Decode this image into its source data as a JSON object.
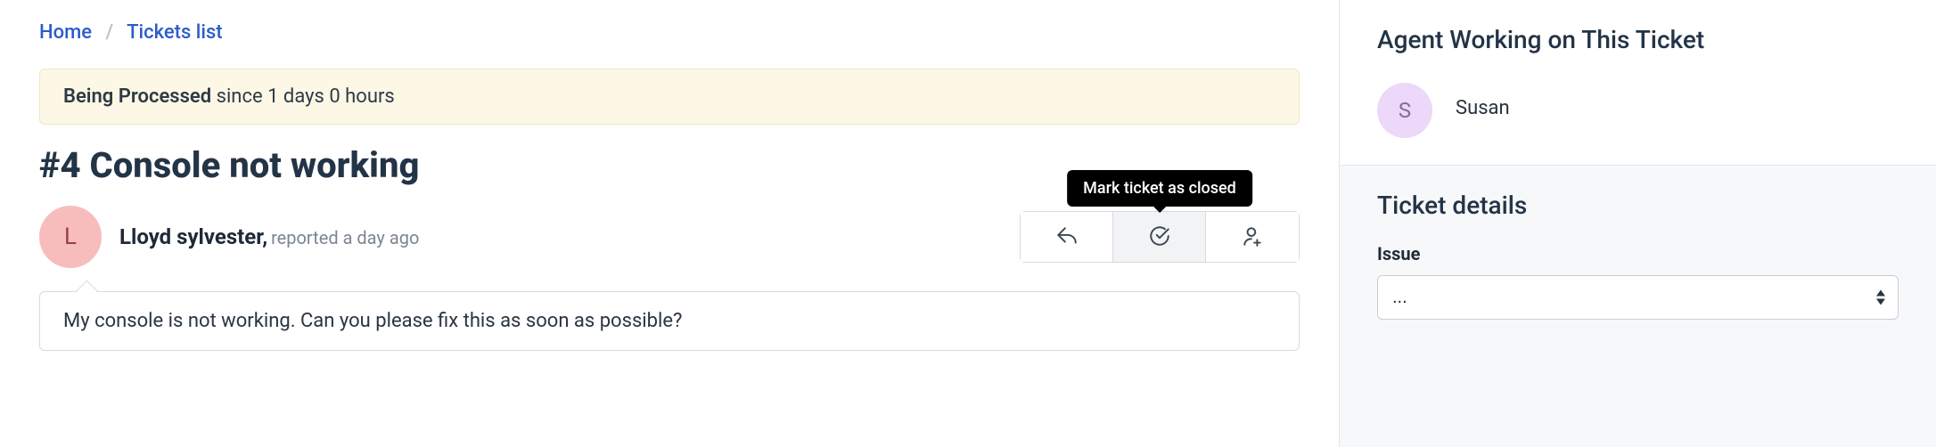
{
  "breadcrumb": {
    "home": "Home",
    "list": "Tickets list"
  },
  "status": {
    "label": "Being Processed",
    "since": "since 1 days 0 hours"
  },
  "ticket": {
    "title": "#4 Console not working",
    "reporter": {
      "initial": "L",
      "name": "Lloyd sylvester",
      "time": "reported a day ago"
    },
    "message": "My console is not working. Can you please fix this as soon as possible?"
  },
  "actions": {
    "tooltip_close": "Mark ticket as closed"
  },
  "sidebar": {
    "agent_heading": "Agent Working on This Ticket",
    "agent": {
      "initial": "S",
      "name": "Susan"
    },
    "details_heading": "Ticket details",
    "issue_label": "Issue",
    "issue_value": "..."
  }
}
